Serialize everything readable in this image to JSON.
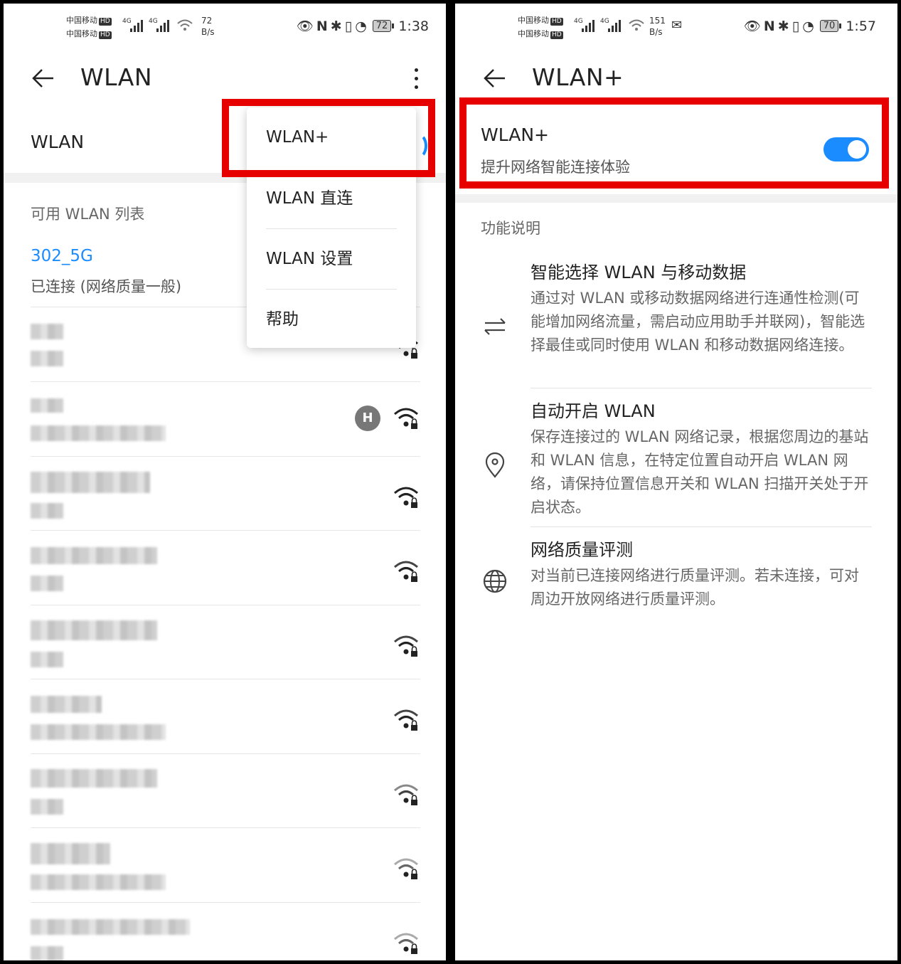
{
  "left": {
    "status": {
      "carrier1": "中国移动",
      "carrier2": "中国移动",
      "hd": "HD",
      "net1": "4G",
      "net2": "4G",
      "speed_value": "72",
      "speed_unit": "B/s",
      "battery": "72",
      "time": "1:38"
    },
    "appbar": {
      "title": "WLAN"
    },
    "wlan_label": "WLAN",
    "menu": [
      "WLAN+",
      "WLAN 直连",
      "WLAN 设置",
      "帮助"
    ],
    "list_header": "可用 WLAN 列表",
    "connected": {
      "ssid": "302_5G",
      "status": "已连接 (网络质量一般)"
    },
    "hilink_glyph": "H"
  },
  "right": {
    "status": {
      "carrier1": "中国移动",
      "carrier2": "中国移动",
      "hd": "HD",
      "net1": "4G",
      "net2": "4G",
      "speed_value": "151",
      "speed_unit": "B/s",
      "battery": "70",
      "time": "1:57"
    },
    "appbar": {
      "title": "WLAN+"
    },
    "plus": {
      "title": "WLAN+",
      "subtitle": "提升网络智能连接体验",
      "enabled": true
    },
    "section": "功能说明",
    "features": [
      {
        "icon": "swap-arrows-icon",
        "title": "智能选择 WLAN 与移动数据",
        "desc": "通过对 WLAN 或移动数据网络进行连通性检测(可能增加网络流量，需启动应用助手并联网)，智能选择最佳或同时使用 WLAN 和移动数据网络连接。"
      },
      {
        "icon": "location-pin-icon",
        "title": "自动开启 WLAN",
        "desc": "保存连接过的 WLAN 网络记录，根据您周边的基站和 WLAN 信息，在特定位置自动开启 WLAN 网络，请保持位置信息开关和 WLAN 扫描开关处于开启状态。"
      },
      {
        "icon": "globe-icon",
        "title": "网络质量评测",
        "desc": "对当前已连接网络进行质量评测。若未连接，可对周边开放网络进行质量评测。"
      }
    ]
  },
  "colors": {
    "accent": "#1a8cff",
    "highlight": "#e60000"
  }
}
